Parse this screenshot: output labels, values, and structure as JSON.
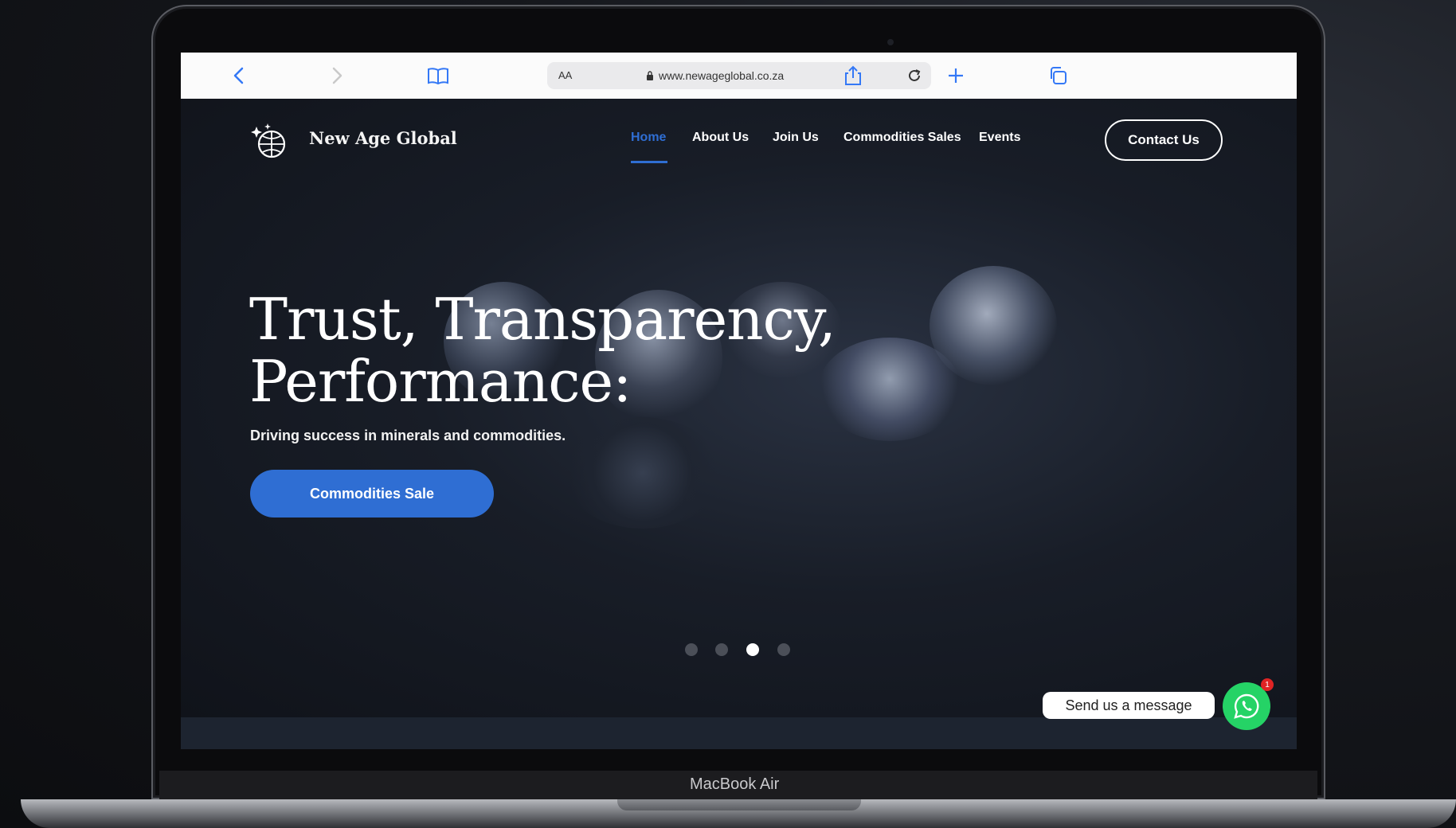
{
  "browser": {
    "aa_label": "AA",
    "url": "www.newageglobal.co.za"
  },
  "site": {
    "brand": "New Age Global",
    "nav": [
      "Home",
      "About Us",
      "Join Us",
      "Commodities Sales",
      "Events"
    ],
    "contact_button": "Contact Us"
  },
  "hero": {
    "headline_line1": "Trust, Transparency,",
    "headline_line2": "Performance:",
    "subtext": "Driving success in minerals and commodities.",
    "cta": "Commodities Sale",
    "slide_count": 4,
    "active_slide": 3
  },
  "whatsapp": {
    "label": "Send us a message",
    "badge": "1"
  },
  "device": {
    "label": "MacBook Air"
  },
  "colors": {
    "accent": "#2f6ed3",
    "whatsapp": "#25d366",
    "browser_blue": "#3478f6"
  }
}
